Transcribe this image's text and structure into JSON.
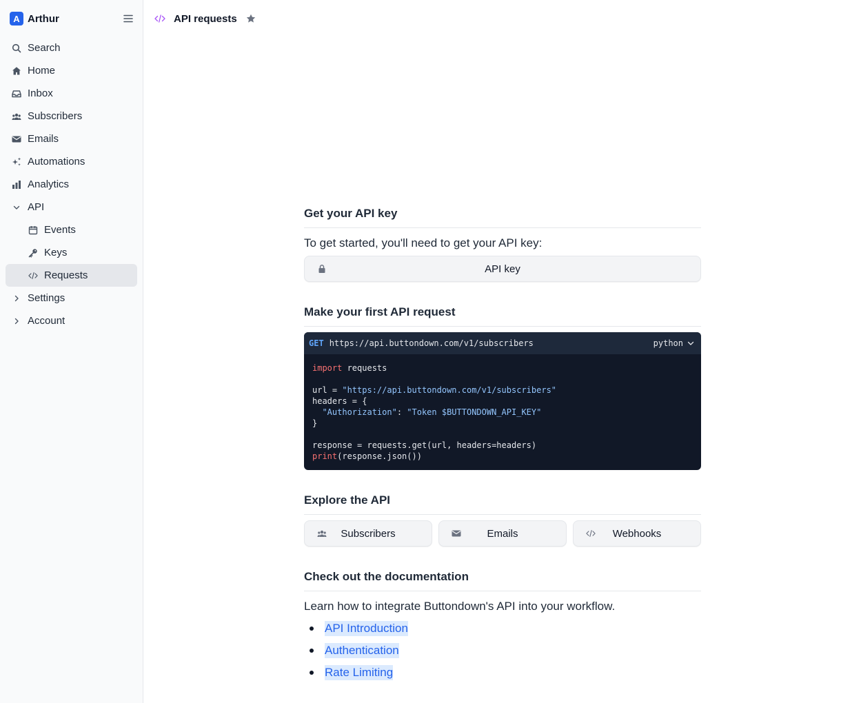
{
  "brand": {
    "logo_letter": "A",
    "name": "Arthur"
  },
  "sidebar": {
    "items": [
      {
        "label": "Search",
        "icon": "search-icon"
      },
      {
        "label": "Home",
        "icon": "home-icon"
      },
      {
        "label": "Inbox",
        "icon": "inbox-icon"
      },
      {
        "label": "Subscribers",
        "icon": "users-icon"
      },
      {
        "label": "Emails",
        "icon": "envelope-icon"
      },
      {
        "label": "Automations",
        "icon": "sparkle-icon"
      },
      {
        "label": "Analytics",
        "icon": "bar-chart-icon"
      },
      {
        "label": "API",
        "icon": "chevron-down-icon",
        "expanded": true
      },
      {
        "label": "Events",
        "icon": "calendar-icon"
      },
      {
        "label": "Keys",
        "icon": "key-icon"
      },
      {
        "label": "Requests",
        "icon": "code-icon",
        "active": true
      },
      {
        "label": "Settings",
        "icon": "chevron-right-icon"
      },
      {
        "label": "Account",
        "icon": "chevron-right-icon"
      }
    ]
  },
  "header": {
    "title": "API requests",
    "icon": "code-icon"
  },
  "sections": {
    "api_key": {
      "title": "Get your API key",
      "text": "To get started, you'll need to get your API key:",
      "button_label": "API key"
    },
    "first_request": {
      "title": "Make your first API request",
      "method": "GET",
      "url": "https://api.buttondown.com/v1/subscribers",
      "language": "python"
    },
    "explore": {
      "title": "Explore the API",
      "buttons": [
        {
          "label": "Subscribers",
          "icon": "users-icon"
        },
        {
          "label": "Emails",
          "icon": "envelope-icon"
        },
        {
          "label": "Webhooks",
          "icon": "code-icon"
        }
      ]
    },
    "docs": {
      "title": "Check out the documentation",
      "text": "Learn how to integrate Buttondown's API into your workflow.",
      "links": [
        "API Introduction",
        "Authentication",
        "Rate Limiting"
      ]
    }
  },
  "code": {
    "line1_kw": "import",
    "line1_rest": " requests",
    "line3_pre": "url = ",
    "line3_str": "\"https://api.buttondown.com/v1/subscribers\"",
    "line4": "headers = {",
    "line5_pre": "  ",
    "line5_key": "\"Authorization\"",
    "line5_mid": ": ",
    "line5_val": "\"Token $BUTTONDOWN_API_KEY\"",
    "line6": "}",
    "line8": "response = requests.get(url, headers=headers)",
    "line9_fn": "print",
    "line9_rest": "(response.json())"
  },
  "colors": {
    "accent": "#2563eb",
    "code_bg": "#111827",
    "link_bg": "#dbeafe"
  }
}
